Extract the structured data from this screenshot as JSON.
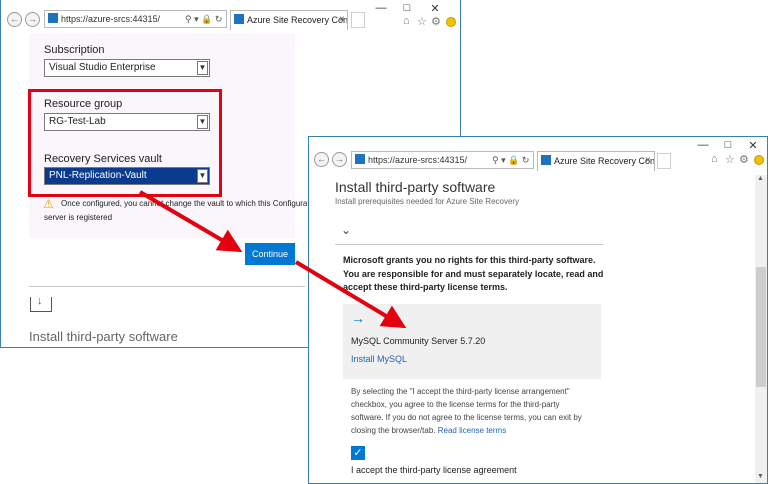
{
  "colors": {
    "accent": "#0078d4",
    "highlight_red": "#e3000f",
    "selected_bg": "#0a3b8f"
  },
  "back_window": {
    "url": "https://azure-srcs:44315/",
    "tab_title": "Azure Site Recovery Config...",
    "subscription_label": "Subscription",
    "subscription_value": "Visual Studio Enterprise",
    "resource_group_label": "Resource group",
    "resource_group_value": "RG-Test-Lab",
    "vault_label": "Recovery Services vault",
    "vault_value": "PNL-Replication-Vault",
    "warning_text_line1": "Once configured, you cannot change the vault to which this Configuration",
    "warning_text_line2": "server is registered",
    "continue_label": "Continue",
    "section_title": "Install third-party software"
  },
  "front_window": {
    "url": "https://azure-srcs:44315/",
    "tab_title": "Azure Site Recovery Config...",
    "page_title": "Install third-party software",
    "page_subtitle": "Install prerequisites needed for Azure Site Recovery",
    "notice_line1": "Microsoft grants you no rights for this third-party software.",
    "notice_line2": "You are responsible for and must separately locate, read and",
    "notice_line3": "accept these third-party license terms.",
    "product_name": "MySQL Community Server 5.7.20",
    "install_link": "Install MySQL",
    "license_text_line1": "By selecting the \"I accept the third-party license arrangement\"",
    "license_text_line2": "checkbox, you agree to the license terms for the third-party",
    "license_text_line3": "software. If you do not agree to the license terms, you can exit by",
    "license_text_line4": "closing the browser/tab.",
    "license_link": "Read license terms",
    "accept_label": "I accept the third-party license agreement",
    "accept_checked": true
  }
}
